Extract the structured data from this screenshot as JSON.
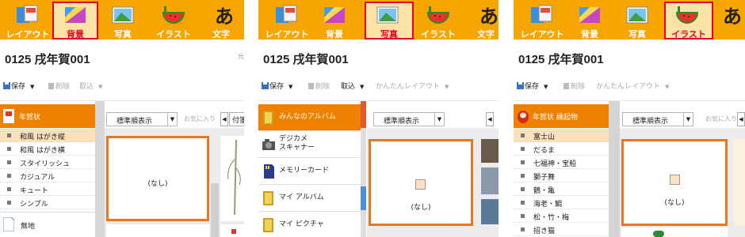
{
  "toolbar": {
    "layout": "レイアウト",
    "background": "背景",
    "photo": "写真",
    "illust": "イラスト",
    "text": "文字"
  },
  "document": {
    "title": "0125 戌年賀001",
    "user_fragment": "元"
  },
  "actions": {
    "save": "保存",
    "delete": "削除",
    "import": "取込",
    "easy_layout": "かんたんレイアウト"
  },
  "panel1": {
    "category": "年賀状",
    "items": [
      "和風 はがき縦",
      "和風 はがき横",
      "スタイリッシュ",
      "カジュアル",
      "キュート",
      "シンプル"
    ],
    "plain": "無地"
  },
  "panel2": {
    "albums": [
      {
        "label": "みんなのアルバム"
      },
      {
        "label1": "デジカメ",
        "label2": "スキャナー"
      },
      {
        "label": "メモリーカード"
      },
      {
        "label": "マイ アルバム"
      },
      {
        "label": "マイ ピクチャ"
      }
    ]
  },
  "panel3": {
    "category": "年賀状 縁起物",
    "items": [
      "富士山",
      "だるま",
      "七福神・宝船",
      "獅子舞",
      "鶴・亀",
      "海老・鯛",
      "松・竹・梅",
      "招き猫"
    ]
  },
  "main": {
    "sort": "標準順表示",
    "favorite": "お気に入り",
    "none": "(なし)",
    "tag": "付箋"
  },
  "colors": {
    "toolbar": "#f7a500",
    "selected_category": "#f08000",
    "selected_item": "#fde0b8",
    "tool_highlight": "#e8002d",
    "card_border": "#e87722"
  }
}
